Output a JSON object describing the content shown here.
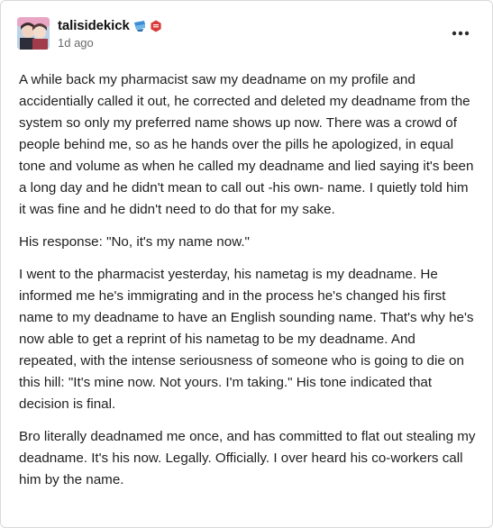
{
  "post": {
    "username": "talisidekick",
    "timestamp": "1d ago",
    "paragraphs": [
      "A while back my pharmacist saw my deadname on my profile and accidentially called it out, he corrected and deleted my deadname from the system so only my preferred name shows up now. There was a crowd of people behind me, so as he hands over the pills he apologized, in equal tone and volume as when he called my deadname and lied saying it's been a long day and he didn't mean to call out -his own- name. I quietly told him it was fine and he didn't need to do that for my sake.",
      "His response: \"No, it's my name now.\"",
      "I went to the pharmacist yesterday, his nametag is my deadname. He informed me he's immigrating and in the process he's changed his first name to my deadname to have an English sounding name. That's why he's now able to get a reprint of his nametag to be my deadname. And repeated, with the intense seriousness of someone who is going to die on this hill: \"It's mine now. Not yours. I'm taking.\" His tone indicated that decision is final.",
      "Bro literally deadnamed me once, and has committed to flat out stealing my deadname. It's his now. Legally. Officially. I over heard his co-workers call him by the name."
    ]
  },
  "icons": {
    "avatar": "avatar-image",
    "badge_1": "blue-badge-icon",
    "badge_2": "red-badge-icon",
    "more": "more-options-icon"
  },
  "colors": {
    "username": "#111111",
    "timestamp": "#6b6b6b",
    "body_text": "#1e1e1e",
    "badge_blue": "#3b8fd6",
    "badge_red": "#d93a3a"
  }
}
